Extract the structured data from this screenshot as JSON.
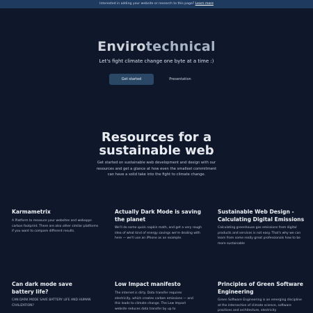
{
  "banner": {
    "text": "Interested in adding your website or research to this page?",
    "link": "Learn more"
  },
  "hero": {
    "brand_part1": "Enviro",
    "brand_part2": "technical",
    "tagline": "Let's fight climate change one byte at a time :)",
    "primary_button": "Get started",
    "secondary_button": "Presentation"
  },
  "section": {
    "title_line1": "Resources for a",
    "title_line2": "sustainable web",
    "intro": "Get started on sustainable web development and design with our resources and get a glance at how even the smallest commitment can have a solid take into the fight to climate change."
  },
  "cards": [
    {
      "title": "Karmametrix",
      "text": "A Platform to measure your websites and webapps carbon footprint. There are also other similar platforms if you want to compare different results."
    },
    {
      "title": "Actually Dark Mode is saving the planet",
      "text": "We'll do some quick napkin math, and get a very rough idea of what kind of energy savings we're dealing with here — we'll use an iPhone as an example."
    },
    {
      "title": "Sustainable Web Design - Calculating Digital Emissions",
      "text": "Calculating greenhouse gas emissions from digital products and services is not easy. That's why we can learn from some really great professionals how to be more sustainable"
    },
    {
      "title": "Can dark mode save battery life?",
      "text": "CAN DARK MODE SAVE BATTERY LIFE AND HUMAN CIVILIZATION?"
    },
    {
      "title": "Low Impact manifesto",
      "text": "The internet is dirty. Data transfer requires electricity, which creates carbon emissions — and this leads to climate change. The Low Impact website reduces data transfer by up to"
    },
    {
      "title": "Principles of Green Software Engineering",
      "text": "Green Software Engineering is an emerging discipline at the intersection of climate science, software practices and architecture, electricity"
    }
  ]
}
